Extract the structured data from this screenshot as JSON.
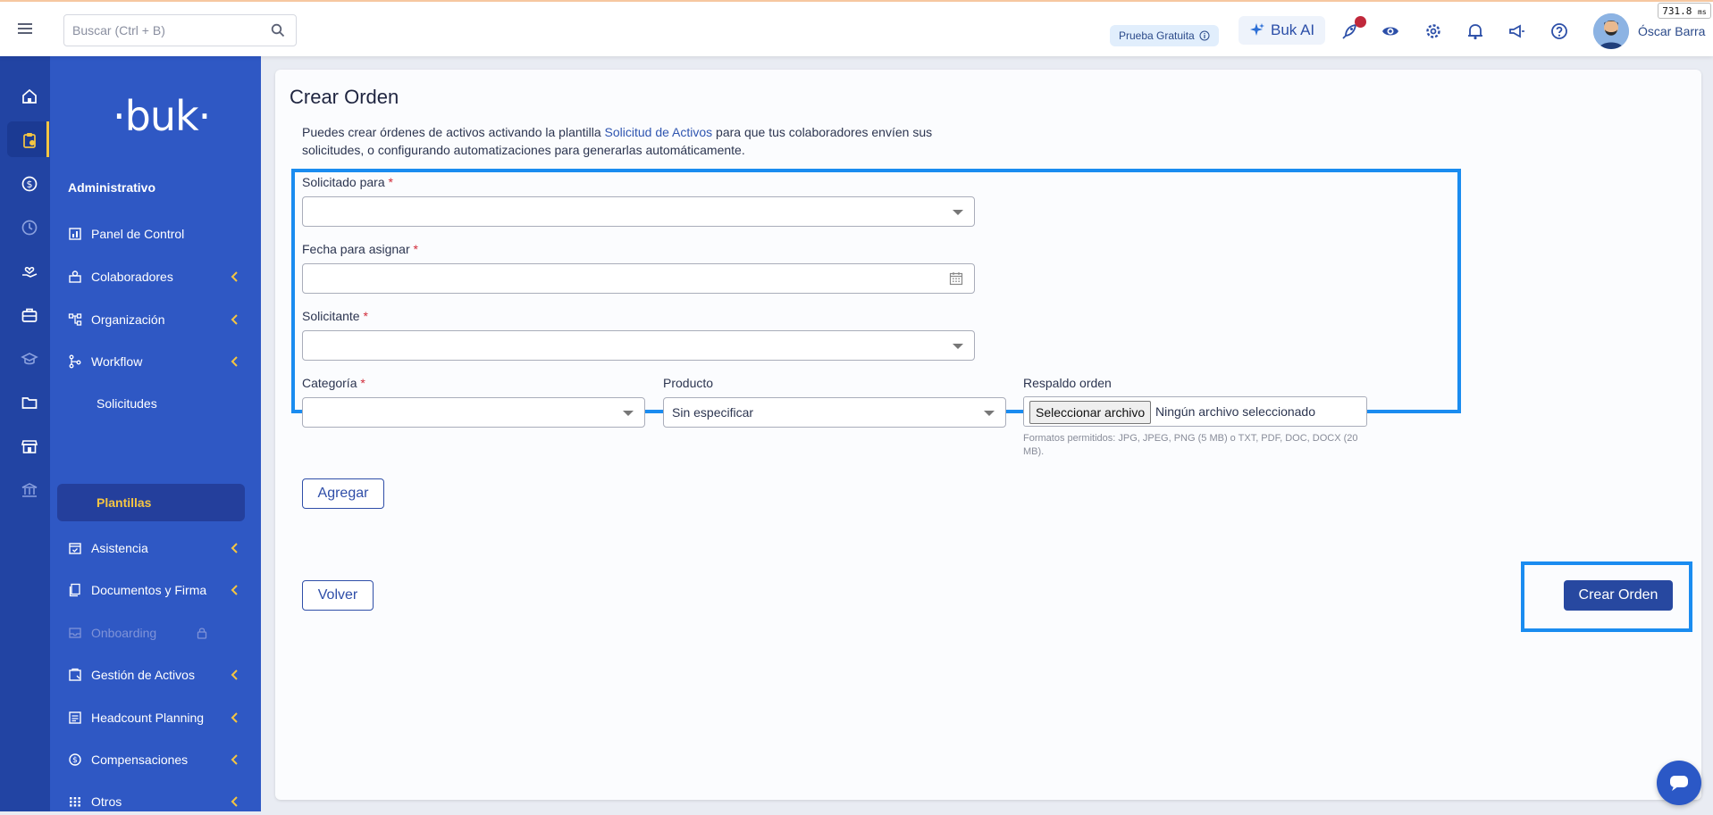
{
  "topbar": {
    "search_placeholder": "Buscar (Ctrl + B)",
    "trial_label": "Prueba Gratuita",
    "ai_label": "Buk AI",
    "user_name": "Óscar Barra",
    "timing": "731.8",
    "timing_unit": "ms"
  },
  "brand": {
    "logo_text": "·buk·"
  },
  "sidebar": {
    "section": "Administrativo",
    "items": [
      {
        "label": "Panel de Control"
      },
      {
        "label": "Colaboradores"
      },
      {
        "label": "Organización"
      },
      {
        "label": "Workflow"
      },
      {
        "label": "Solicitudes"
      },
      {
        "label": "Plantillas"
      },
      {
        "label": "Asistencia"
      },
      {
        "label": "Documentos y Firma"
      },
      {
        "label": "Onboarding"
      },
      {
        "label": "Gestión de Activos"
      },
      {
        "label": "Headcount Planning"
      },
      {
        "label": "Compensaciones"
      },
      {
        "label": "Otros"
      }
    ]
  },
  "page": {
    "title": "Crear Orden",
    "desc_before": "Puedes crear órdenes de activos activando la plantilla ",
    "desc_link": "Solicitud de Activos",
    "desc_after": " para que tus colaboradores envíen sus solicitudes, o configurando automatizaciones para generarlas automáticamente."
  },
  "form": {
    "solicitado_para": {
      "label": "Solicitado para",
      "required": "*",
      "value": ""
    },
    "fecha": {
      "label": "Fecha para asignar",
      "required": "*",
      "value": ""
    },
    "solicitante": {
      "label": "Solicitante",
      "required": "*",
      "value": ""
    },
    "categoria": {
      "label": "Categoría",
      "required": "*",
      "value": ""
    },
    "producto": {
      "label": "Producto",
      "value": "Sin especificar"
    },
    "respaldo": {
      "label": "Respaldo orden",
      "button": "Seleccionar archivo",
      "status": "Ningún archivo seleccionado",
      "hint": "Formatos permitidos: JPG, JPEG, PNG (5 MB) o TXT, PDF, DOC, DOCX (20 MB)."
    }
  },
  "buttons": {
    "agregar": "Agregar",
    "volver": "Volver",
    "crear": "Crear Orden"
  },
  "colors": {
    "nav_bg": "#2f58c4",
    "rail_bg": "#2244a3",
    "accent": "#f4c542",
    "primary": "#2748a0",
    "highlight": "#1a8cf0"
  }
}
